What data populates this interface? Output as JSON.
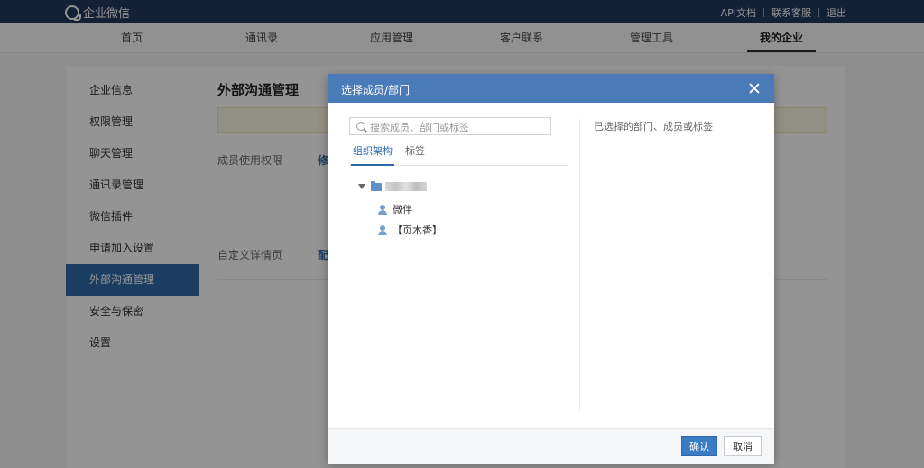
{
  "topbar": {
    "logo_text": "企业微信",
    "links": [
      "API文档",
      "联系客服",
      "退出"
    ]
  },
  "nav": {
    "items": [
      "首页",
      "通讯录",
      "应用管理",
      "客户联系",
      "管理工具",
      "我的企业"
    ],
    "active": "我的企业"
  },
  "sidebar": {
    "items": [
      "企业信息",
      "权限管理",
      "聊天管理",
      "通讯录管理",
      "微信插件",
      "申请加入设置",
      "外部沟通管理",
      "安全与保密",
      "设置"
    ],
    "active": "外部沟通管理"
  },
  "content": {
    "title": "外部沟通管理",
    "row1_label": "成员使用权限",
    "row1_link": "修",
    "row2_label": "自定义详情页",
    "row2_link": "配"
  },
  "modal": {
    "title": "选择成员/部门",
    "search_placeholder": "搜索成员、部门或标签",
    "tabs": [
      "组织架构",
      "标签"
    ],
    "tree": {
      "members": [
        "微伴",
        "【页木香】"
      ]
    },
    "selected_label": "已选择的部门、成员或标签",
    "confirm": "确认",
    "cancel": "取消"
  },
  "colors": {
    "topbar": "#1f3a5e",
    "modal_header": "#4a7ab8",
    "sidebar_active": "#2f6aa8",
    "primary_button": "#3a7cc4"
  }
}
